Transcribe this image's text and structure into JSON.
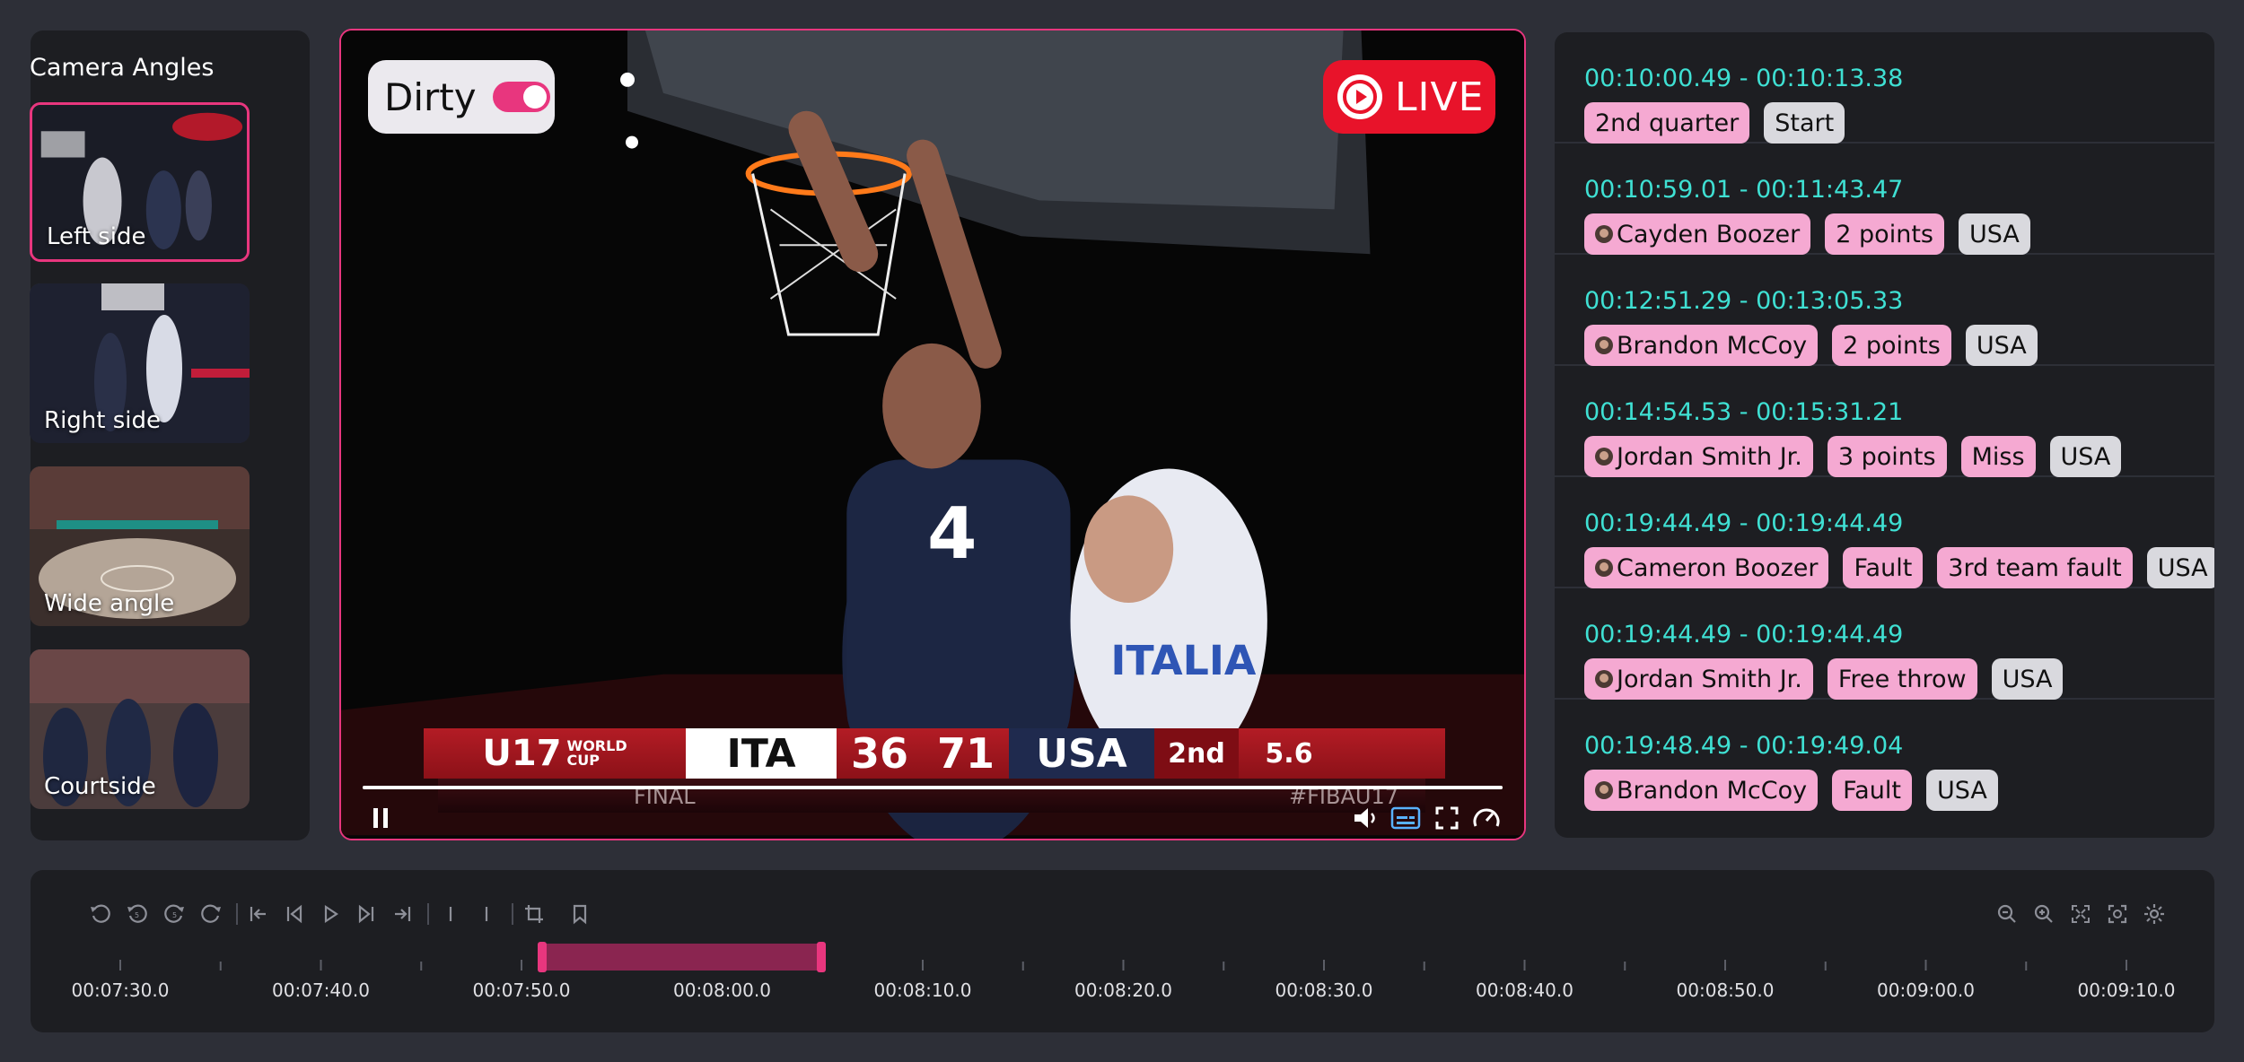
{
  "camera_panel": {
    "title": "Camera Angles",
    "angles": [
      {
        "label": "Left side",
        "active": true
      },
      {
        "label": "Right side",
        "active": false
      },
      {
        "label": "Wide angle",
        "active": false
      },
      {
        "label": "Courtside",
        "active": false
      }
    ]
  },
  "player": {
    "dirty_label": "Dirty",
    "dirty_on": true,
    "live_label": "LIVE",
    "progress": 1.0,
    "scoreboard": {
      "event_big": "U17",
      "event_small_1": "WORLD",
      "event_small_2": "CUP",
      "team1": "ITA",
      "score1": "36",
      "score2": "71",
      "team2": "USA",
      "quarter": "2nd",
      "clock": "5.6",
      "status": "FINAL",
      "hashtag": "#FIBAU17"
    },
    "controls": [
      "pause-icon",
      "volume-icon",
      "subtitles-icon",
      "fullscreen-icon",
      "speed-icon"
    ]
  },
  "events": [
    {
      "time": "00:10:00.49 - 00:10:13.38",
      "tags": [
        {
          "text": "2nd quarter",
          "kind": "pink"
        },
        {
          "text": "Start",
          "kind": "grey"
        }
      ]
    },
    {
      "time": "00:10:59.01 - 00:11:43.47",
      "tags": [
        {
          "text": "Cayden Boozer",
          "kind": "player"
        },
        {
          "text": "2 points",
          "kind": "pink"
        },
        {
          "text": "USA",
          "kind": "grey"
        }
      ]
    },
    {
      "time": "00:12:51.29 - 00:13:05.33",
      "tags": [
        {
          "text": "Brandon McCoy",
          "kind": "player"
        },
        {
          "text": "2 points",
          "kind": "pink"
        },
        {
          "text": "USA",
          "kind": "grey"
        }
      ]
    },
    {
      "time": "00:14:54.53 - 00:15:31.21",
      "tags": [
        {
          "text": "Jordan Smith Jr.",
          "kind": "player"
        },
        {
          "text": "3 points",
          "kind": "pink"
        },
        {
          "text": "Miss",
          "kind": "pink"
        },
        {
          "text": "USA",
          "kind": "grey"
        }
      ]
    },
    {
      "time": "00:19:44.49 - 00:19:44.49",
      "tags": [
        {
          "text": "Cameron Boozer",
          "kind": "player"
        },
        {
          "text": "Fault",
          "kind": "pink"
        },
        {
          "text": "3rd team fault",
          "kind": "pink"
        },
        {
          "text": "USA",
          "kind": "grey"
        }
      ]
    },
    {
      "time": "00:19:44.49 - 00:19:44.49",
      "tags": [
        {
          "text": "Jordan Smith Jr.",
          "kind": "player"
        },
        {
          "text": "Free throw",
          "kind": "pink"
        },
        {
          "text": "USA",
          "kind": "grey"
        }
      ]
    },
    {
      "time": "00:19:48.49 - 00:19:49.04",
      "tags": [
        {
          "text": "Brandon McCoy",
          "kind": "player"
        },
        {
          "text": "Fault",
          "kind": "pink"
        },
        {
          "text": "USA",
          "kind": "grey"
        }
      ]
    }
  ],
  "timeline": {
    "tick_labels": [
      "00:07:30.0",
      "00:07:40.0",
      "00:07:50.0",
      "00:08:00.0",
      "00:08:10.0",
      "00:08:20.0",
      "00:08:30.0",
      "00:08:40.0",
      "00:08:50.0",
      "00:09:00.0",
      "00:09:10.0"
    ],
    "selection_start": "00:07:51.0",
    "selection_end": "00:08:05.0",
    "left_tools": [
      "rewind-icon",
      "back-5-icon",
      "forward-5-icon",
      "forward-icon",
      "go-start-icon",
      "prev-frame-icon",
      "play-icon",
      "next-frame-icon",
      "go-end-icon",
      "mark-in-icon",
      "mark-out-icon",
      "crop-icon",
      "bookmark-icon"
    ],
    "right_tools": [
      "zoom-out-icon",
      "zoom-in-icon",
      "fit-icon",
      "focus-icon",
      "settings-icon"
    ]
  },
  "colors": {
    "accent": "#e8367e",
    "time_text": "#3fe0d3",
    "tag_pink": "#f5a9d2",
    "tag_grey": "#d9d9de",
    "live": "#e8132a"
  }
}
